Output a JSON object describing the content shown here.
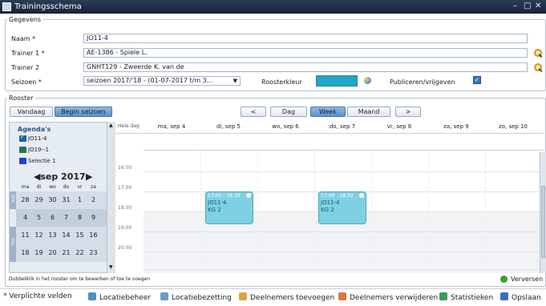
{
  "window": {
    "title": "Trainingsschema"
  },
  "gegevens": {
    "legend": "Gegevens",
    "naam_label": "Naam *",
    "naam_value": "JO11-4",
    "trainer1_label": "Trainer 1 *",
    "trainer1_value": "AE-1386 - Spiele L.",
    "trainer2_label": "Trainer 2",
    "trainer2_value": "GNHT129 - Zweerde K. van de",
    "seizoen_label": "Seizoen *",
    "seizoen_value": "seizoen 2017/'18 - (01-07-2017 t/m 3...",
    "roosterkleur_label": "Roosterkleur",
    "roosterkleur_color": "#1fa6c8",
    "publiceren_label": "Publiceren/vrijgeven",
    "publiceren_checked": true
  },
  "rooster": {
    "legend": "Rooster",
    "vandaag": "Vandaag",
    "begin_seizoen": "Begin seizoen",
    "prev": "<",
    "next": ">",
    "views": [
      "Dag",
      "Week",
      "Maand"
    ],
    "active_view": "Week"
  },
  "sidebar": {
    "agenda_title": "Agenda's",
    "calendars": [
      {
        "label": "JO11-4",
        "color": "#1f5fae",
        "checked": true
      },
      {
        "label": "JO19--1",
        "color": "#2d6e5e",
        "checked": false
      },
      {
        "label": "Selectie 1",
        "color": "#2840c8",
        "checked": false
      }
    ],
    "month_label": "sep 2017",
    "prev_month": "◀",
    "next_month": "▶",
    "weekdays": [
      "ma",
      "di",
      "wo",
      "do",
      "vr",
      "za"
    ],
    "weeks": [
      {
        "band": "aug",
        "days": [
          "28",
          "29",
          "30",
          "31",
          "1",
          "2"
        ]
      },
      {
        "band": "",
        "days": [
          "4",
          "5",
          "6",
          "7",
          "8",
          "9"
        ]
      },
      {
        "band": "",
        "days": [
          "11",
          "12",
          "13",
          "14",
          "15",
          "16"
        ]
      },
      {
        "band": "sep",
        "days": [
          "18",
          "19",
          "20",
          "21",
          "22",
          "23"
        ]
      }
    ]
  },
  "calendar": {
    "allday_label": "Hele dag",
    "days": [
      "ma, sep 4",
      "di, sep 5",
      "wo, sep 6",
      "do, sep 7",
      "vr, sep 8",
      "za, sep 9",
      "zo, sep 10"
    ],
    "hours": [
      "16.00",
      "17.00",
      "18.00",
      "19.00",
      "20.00"
    ],
    "events": [
      {
        "day_index": 1,
        "time": "17:00 - 18:30",
        "title": "JO11-4",
        "location": "KG 2"
      },
      {
        "day_index": 3,
        "time": "17:00 - 18:30",
        "title": "JO11-4",
        "location": "KG 2"
      }
    ]
  },
  "status": {
    "hint": "Dubbelklik in het rooster om te bewerken of toe te voegen",
    "refresh": "Verversen"
  },
  "footer": {
    "required": "* Verplichte velden",
    "locatiebeheer": "Locatiebeheer",
    "locatiebezetting": "Locatiebezetting",
    "deelnemers_toevoegen": "Deelnemers toevoegen",
    "deelnemers_verwijderen": "Deelnemers verwijderen",
    "statistieken": "Statistieken",
    "opslaan": "Opslaan"
  }
}
